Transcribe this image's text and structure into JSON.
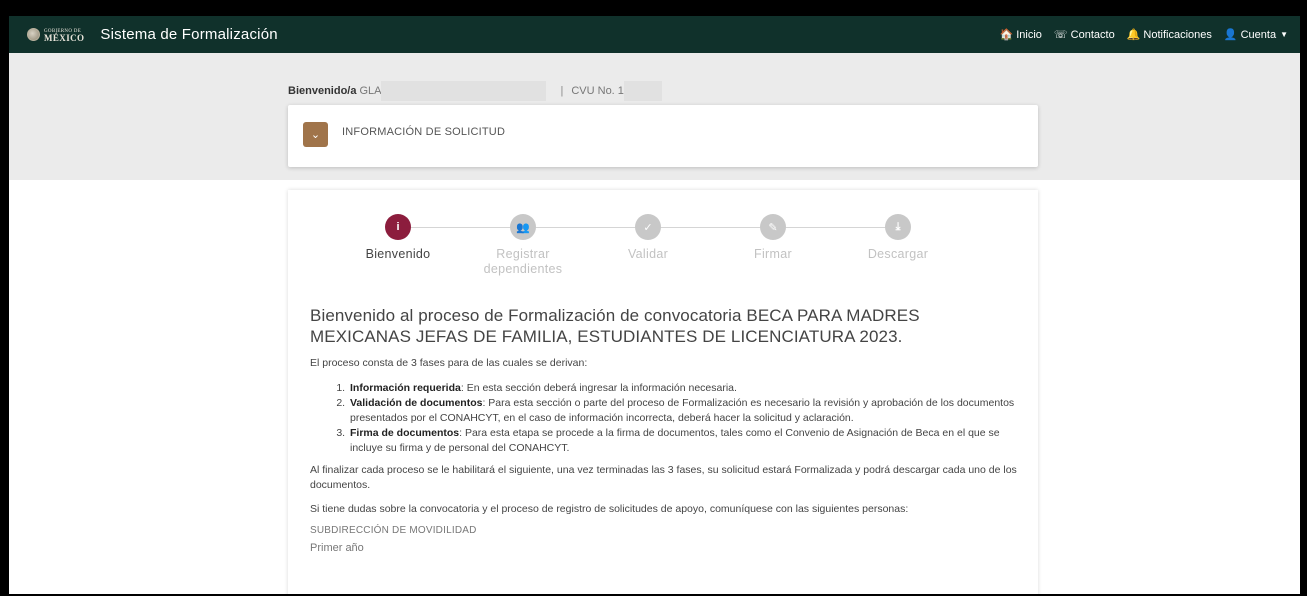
{
  "navbar": {
    "logo_small": "GOBIERNO DE",
    "logo_big": "MÉXICO",
    "app_title": "Sistema de Formalización",
    "links": [
      {
        "icon": "home-icon",
        "glyph": "🏠",
        "label": "Inicio"
      },
      {
        "icon": "contact-icon",
        "glyph": "☏",
        "label": "Contacto"
      },
      {
        "icon": "bell-icon",
        "glyph": "🔔",
        "label": "Notificaciones"
      },
      {
        "icon": "user-icon",
        "glyph": "👤",
        "label": "Cuenta"
      }
    ]
  },
  "header": {
    "welcome_label": "Bienvenido/a",
    "name_partial": "GLA",
    "separator": "|",
    "cvu_label": "CVU No. 1"
  },
  "info_card": {
    "title": "INFORMACIÓN DE SOLICITUD"
  },
  "stepper": {
    "steps": [
      {
        "label": "Bienvenido",
        "icon": "info-icon",
        "glyph": "i",
        "active": true
      },
      {
        "label": "Registrar dependientes",
        "icon": "users-icon",
        "glyph": "👥",
        "active": false
      },
      {
        "label": "Validar",
        "icon": "check-icon",
        "glyph": "✓",
        "active": false
      },
      {
        "label": "Firmar",
        "icon": "pencil-icon",
        "glyph": "✎",
        "active": false
      },
      {
        "label": "Descargar",
        "icon": "download-icon",
        "glyph": "⤓",
        "active": false
      }
    ]
  },
  "content": {
    "heading": "Bienvenido al proceso de Formalización de convocatoria BECA PARA MADRES MEXICANAS JEFAS DE FAMILIA, ESTUDIANTES DE LICENCIATURA 2023.",
    "intro": "El proceso consta de 3 fases para de las cuales se derivan:",
    "phases": [
      {
        "title": "Información requerida",
        "text": ": En esta sección deberá ingresar la información necesaria."
      },
      {
        "title": "Validación de documentos",
        "text": ": Para esta sección o parte del proceso de Formalización es necesario la revisión y aprobación de los documentos presentados por el CONAHCYT, en el caso de información incorrecta, deberá hacer la solicitud y aclaración."
      },
      {
        "title": "Firma de documentos",
        "text": ": Para esta etapa se procede a la firma de documentos, tales como el Convenio de Asignación de Beca en el que se incluye su firma y de personal del CONAHCYT."
      }
    ],
    "finish_text": "Al finalizar cada proceso se le habilitará el siguiente, una vez terminadas las 3 fases, su solicitud estará Formalizada y podrá descargar cada uno de los documentos.",
    "contact_text": "Si tiene dudas sobre la convocatoria y el proceso de registro de solicitudes de apoyo, comuníquese con las siguientes personas:",
    "subdireccion": "SUBDIRECCIÓN DE MOVIDILIDAD",
    "year": "Primer año"
  },
  "colors": {
    "navbar": "#10312b",
    "active_step": "#8c1d3d",
    "accent": "#a0744a"
  }
}
